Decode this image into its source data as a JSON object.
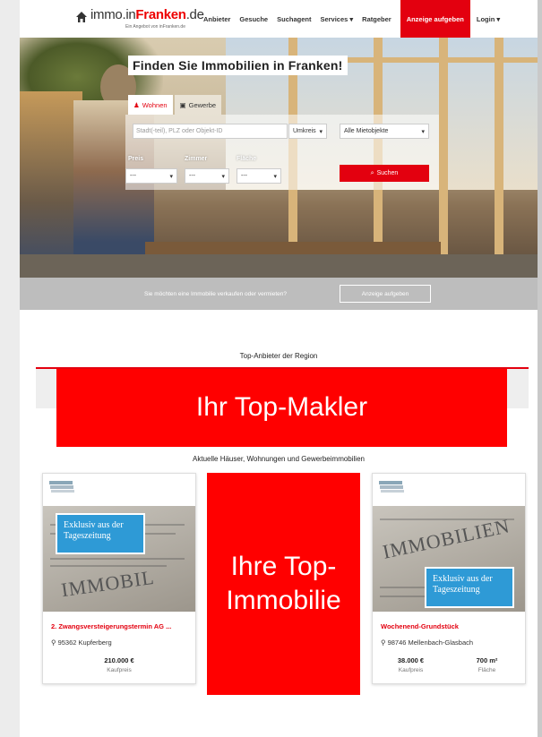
{
  "header": {
    "logo_main": "immo.in",
    "logo_brand": "Franken",
    "logo_tld": ".de",
    "logo_sub": "Ein Angebot von inFranken.de",
    "nav": [
      "Anbieter",
      "Gesuche",
      "Suchagent",
      "Services ▾",
      "Ratgeber"
    ],
    "cta": "Anzeige aufgeben",
    "login": "Login ▾"
  },
  "hero": {
    "title": "Finden Sie Immobilien in Franken!",
    "tabs": [
      "Wohnen",
      "Gewerbe"
    ],
    "active_tab": "Wohnen",
    "search_placeholder": "Stadt(-teil), PLZ oder Objekt-ID",
    "radius": "Umkreis",
    "object_type": "Alle Mietobjekte",
    "labels": {
      "price": "Preis",
      "rooms": "Zimmer",
      "area": "Fläche"
    },
    "price_value": "---",
    "rooms_value": "---",
    "area_value": "---",
    "search_button": "Suchen"
  },
  "sellbar": {
    "text": "Sie möchten eine Immobilie verkaufen oder vermieten?",
    "button": "Anzeige aufgeben"
  },
  "top_provider": {
    "title": "Top-Anbieter der Region",
    "banner": "Ihr Top-Makler"
  },
  "listings": {
    "title": "Aktuelle Häuser, Wohnungen und Gewerbeimmobilien",
    "center_banner": "Ihre Top-Immobilie",
    "cards": [
      {
        "badge": "Exklusiv aus der Tageszeitung",
        "image_word": "IMMOBIL",
        "title": "2. Zwangsversteigerungstermin AG ...",
        "location": "95362 Kupferberg",
        "price": "210.000 €",
        "price_label": "Kaufpreis"
      },
      {
        "badge": "Exklusiv aus der Tageszeitung",
        "image_word": "IMMOBILIEN",
        "title": "Wochenend-Grundstück",
        "location": "98746 Mellenbach-Glasbach",
        "price": "38.000 €",
        "price_label": "Kaufpreis",
        "area": "700 m²",
        "area_label": "Fläche"
      }
    ]
  },
  "colors": {
    "accent": "#e3000f",
    "banner": "#ff0000",
    "badge": "#2e9ad6"
  }
}
